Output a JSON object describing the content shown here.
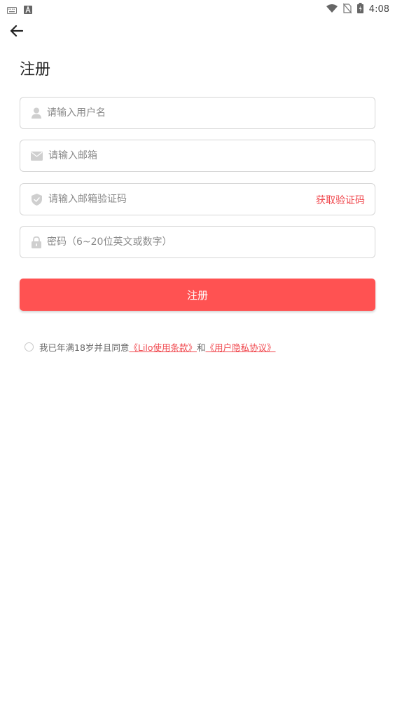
{
  "status_bar": {
    "time": "4:08",
    "left_icons": [
      "keyboard-icon",
      "a-notification-icon"
    ],
    "right_icons": [
      "wifi-icon",
      "no-signal-icon",
      "battery-icon"
    ]
  },
  "header": {
    "back_icon": "arrow-left-icon",
    "title": "注册"
  },
  "form": {
    "username": {
      "placeholder": "请输入用户名",
      "value": "",
      "icon": "user-icon"
    },
    "email": {
      "placeholder": "请输入邮箱",
      "value": "",
      "icon": "mail-icon"
    },
    "code": {
      "placeholder": "请输入邮箱验证码",
      "value": "",
      "icon": "shield-icon",
      "action_label": "获取验证码"
    },
    "password": {
      "placeholder": "密码（6~20位英文或数字）",
      "value": "",
      "icon": "lock-icon"
    },
    "submit_label": "注册"
  },
  "agreement": {
    "prefix": "我已年满18岁并且同意",
    "terms_link": "《Lilo使用条款》",
    "joiner": "和",
    "privacy_link": "《用户隐私协议》",
    "checked": false
  },
  "colors": {
    "accent": "#ff5252",
    "link": "#f0484e",
    "border": "#d6d6d6",
    "placeholder": "#8a8a8a",
    "icon": "#cfcfcf"
  }
}
